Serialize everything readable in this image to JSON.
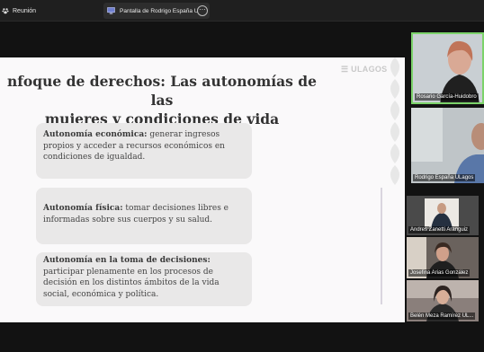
{
  "topbar": {
    "meeting_label": "Reunión",
    "tab_label": "Pantalla de Rodrigo España U",
    "more_label": "⋯"
  },
  "slide": {
    "title_line1": "nfoque de derechos: Las autonomías de las",
    "title_line2": "mujeres y condiciones de vida",
    "logo": "ULAGOS",
    "boxes": [
      {
        "heading": "Autonomía económica:",
        "text": " generar ingresos propios y acceder a recursos económicos en condiciones de igualdad."
      },
      {
        "heading": "Autonomía física:",
        "text": " tomar decisiones libres e informadas sobre sus cuerpos y su salud."
      },
      {
        "heading": "Autonomía en la toma de decisiones:",
        "text": " participar plenamente en los procesos de decisión en los distintos ámbitos de la vida social, económica y política."
      }
    ]
  },
  "participants": [
    {
      "name": "Rosario García-Huidobro"
    },
    {
      "name": "Rodrigo España ULagos"
    },
    {
      "name": "Andres Zanetti Aranguiz"
    },
    {
      "name": "Josefina Arias González"
    },
    {
      "name": "Belén Meza Ramírez UL..."
    }
  ],
  "colors": {
    "active_speaker_border": "#7cd36a",
    "topbar": "#1f1f1f",
    "slide_bg": "#faf9fa"
  }
}
